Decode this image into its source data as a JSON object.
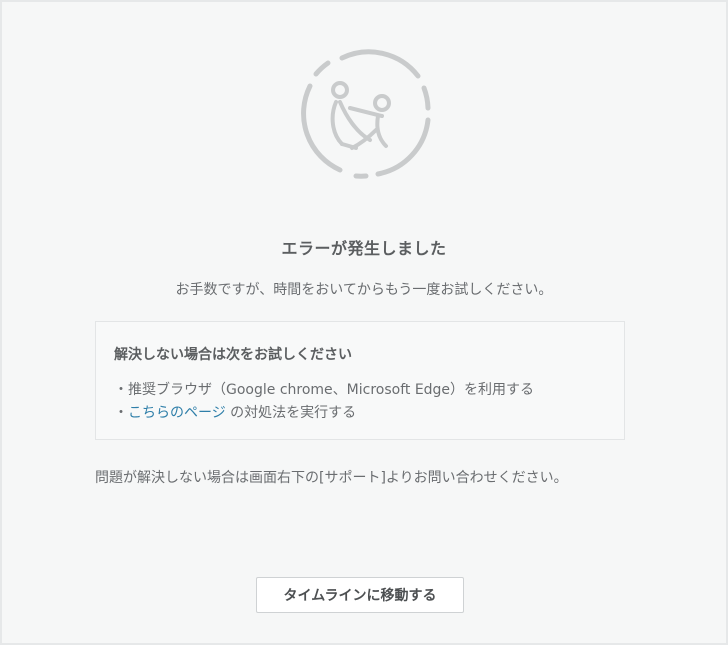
{
  "error": {
    "title": "エラーが発生しました",
    "message": "お手数ですが、時間をおいてからもう一度お試しください。"
  },
  "tips": {
    "heading": "解決しない場合は次をお試しください",
    "line1": "・推奨ブラウザ（Google chrome、Microsoft Edge）を利用する",
    "line2_prefix": "・",
    "line2_link": "こちらのページ",
    "line2_suffix": " の対処法を実行する"
  },
  "support_note": "問題が解決しない場合は画面右下の[サポート]よりお問い合わせください。",
  "actions": {
    "timeline_button": "タイムラインに移動する"
  },
  "colors": {
    "background": "#f6f7f7",
    "illustration": "#c9cbcc",
    "link": "#2f7fa9"
  }
}
